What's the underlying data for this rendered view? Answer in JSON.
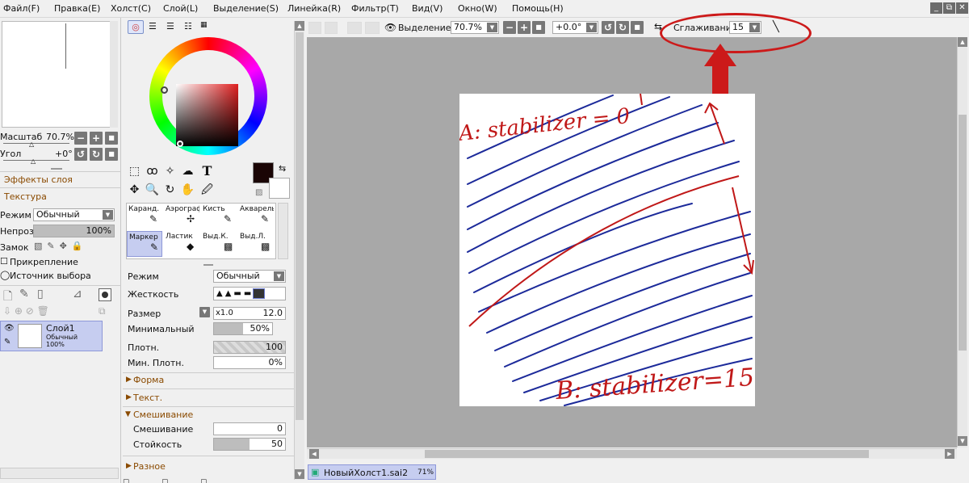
{
  "menu": [
    "Файл(F)",
    "Правка(E)",
    "Холст(C)",
    "Слой(L)",
    "Выделение(S)",
    "Линейка(R)",
    "Фильтр(T)",
    "Вид(V)",
    "Окно(W)",
    "Помощь(H)"
  ],
  "window_buttons": [
    "_",
    "⧉",
    "✕"
  ],
  "navigator": {
    "scale_label": "Масштаб",
    "scale_value": "70.7%",
    "angle_label": "Угол",
    "angle_value": "+0°"
  },
  "layer_panel": {
    "effects": "Эффекты слоя",
    "texture": "Текстура",
    "mode_label": "Режим",
    "mode_value": "Обычный",
    "opacity_label": "Непроз.",
    "opacity_value": "100%",
    "opacity_fraction": 1.0,
    "lock_label": "Замок",
    "clip_label": "Прикрепление",
    "source_label": "Источник выбора",
    "layer_name": "Слой1",
    "layer_mode": "Обычный",
    "layer_opacity": "100%"
  },
  "tools": {
    "brushes": [
      {
        "name": "Каранд.",
        "icon": "pencil-icon"
      },
      {
        "name": "Аэрограф",
        "icon": "airbrush-icon"
      },
      {
        "name": "Кисть",
        "icon": "brush-icon"
      },
      {
        "name": "Акварель",
        "icon": "watercolor-icon"
      },
      {
        "name": "Маркер",
        "icon": "marker-icon"
      },
      {
        "name": "Ластик",
        "icon": "eraser-icon"
      },
      {
        "name": "Выд.К.",
        "icon": "select-pen-icon"
      },
      {
        "name": "Выд.Л.",
        "icon": "select-eraser-icon"
      }
    ]
  },
  "brush_settings": {
    "mode_label": "Режим",
    "mode_value": "Обычный",
    "hardness_label": "Жесткость",
    "size_label": "Размер",
    "size_mult": "x1.0",
    "size_value": "12.0",
    "min_size_label": "Минимальный",
    "min_size_value": "50%",
    "min_size_fraction": 0.5,
    "density_label": "Плотн.",
    "density_value": "100",
    "min_density_label": "Мин. Плотн.",
    "min_density_value": "0%",
    "shape_label": "Форма",
    "texture_label": "Текст.",
    "blending_label": "Смешивание",
    "mixing_label": "Смешивание",
    "mixing_value": "0",
    "persistence_label": "Стойкость",
    "persistence_value": "50",
    "persistence_fraction": 0.5,
    "misc_label": "Разное"
  },
  "toolbar": {
    "selection_label": "Выделение",
    "zoom_value": "70.7%",
    "rotation_value": "+0.0°",
    "stabilizer_label": "Сглаживание",
    "stabilizer_value": "15"
  },
  "canvas": {
    "annotation_a": "A: stabilizer = 0",
    "annotation_b": "B: stabilizer=15"
  },
  "status": {
    "doc_name": "НовыйХолст1.sai2",
    "doc_zoom": "71%"
  },
  "colors": {
    "primary": "#1a0505",
    "secondary": "#ffffff",
    "accent": "#cc1a1a",
    "blue_ink": "#1c2a9a",
    "red_ink": "#c01818"
  }
}
